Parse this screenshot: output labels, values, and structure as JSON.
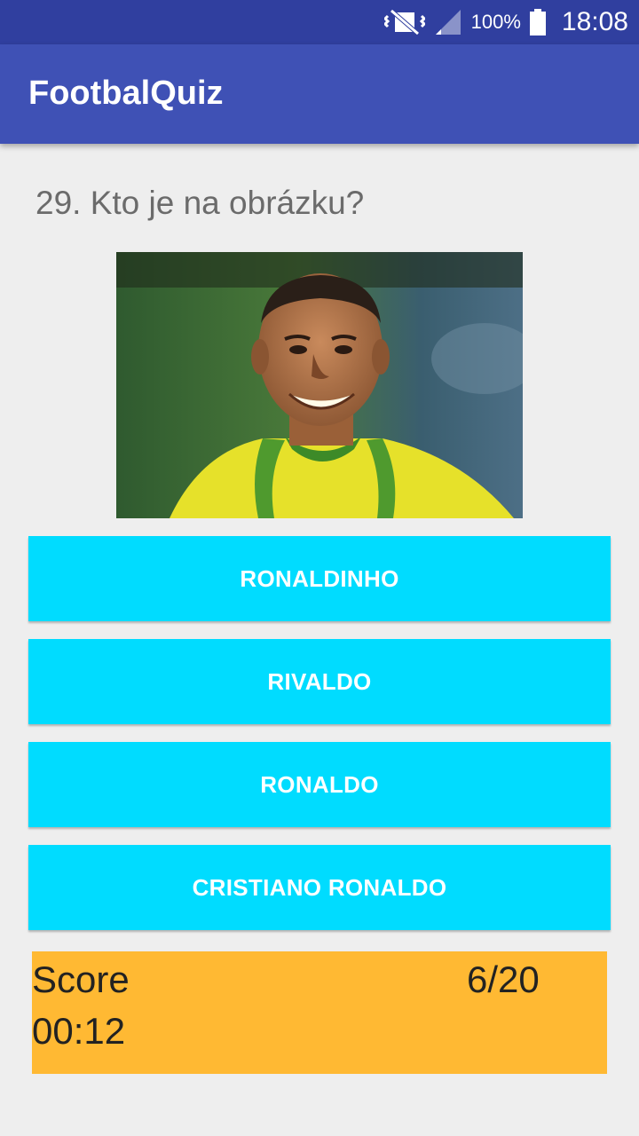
{
  "status_bar": {
    "battery_percent": "100%",
    "time": "18:08",
    "icons": [
      "vibrate-muted-icon",
      "signal-icon",
      "battery-icon"
    ]
  },
  "app_bar": {
    "title": "FootbalQuiz"
  },
  "question": {
    "text": "29. Kto je na obrázku?"
  },
  "answers": [
    "RONALDINHO",
    "RIVALDO",
    "RONALDO",
    "CRISTIANO RONALDO"
  ],
  "score": {
    "label": "Score",
    "value": "6/20",
    "timer": "00:12"
  },
  "colors": {
    "status_bar": "#303f9f",
    "app_bar": "#3f51b5",
    "answer_button": "#00dcff",
    "score_panel": "#ffb933"
  }
}
